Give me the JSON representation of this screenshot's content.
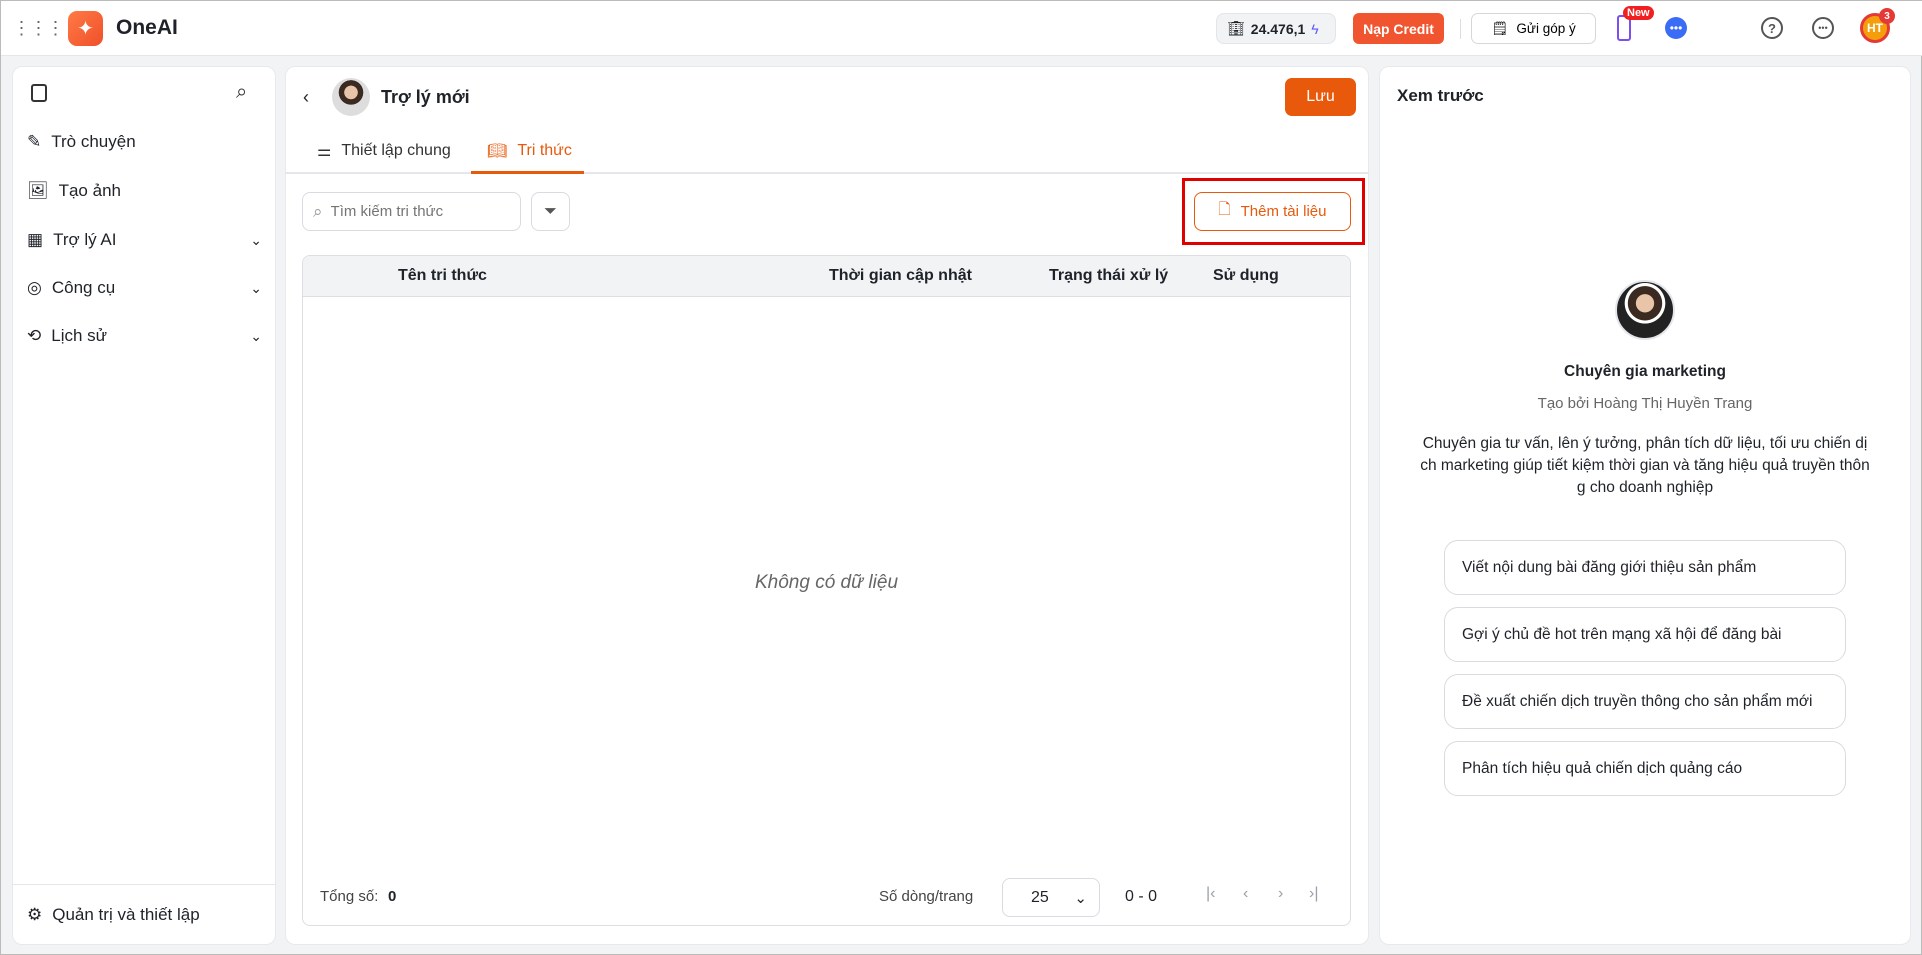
{
  "header": {
    "app_name": "OneAI",
    "credit": "24.476,1",
    "topup_label": "Nạp Credit",
    "feedback_label": "Gửi góp ý",
    "new_badge": "New",
    "avatar_initials": "HT",
    "notif_count": "3"
  },
  "sidebar": {
    "items": [
      {
        "label": "Trò chuyện"
      },
      {
        "label": "Tạo ảnh"
      },
      {
        "label": "Trợ lý AI"
      },
      {
        "label": "Công cụ"
      },
      {
        "label": "Lịch sử"
      }
    ],
    "admin_label": "Quản trị và thiết lập"
  },
  "main": {
    "title": "Trợ lý mới",
    "save_label": "Lưu",
    "tabs": [
      {
        "label": "Thiết lập chung"
      },
      {
        "label": "Tri thức"
      }
    ],
    "search_placeholder": "Tìm kiếm tri thức",
    "add_doc_label": "Thêm tài liệu",
    "table": {
      "columns": [
        "Tên tri thức",
        "Thời gian cập nhật",
        "Trạng thái xử lý",
        "Sử dụng"
      ],
      "empty": "Không có dữ liệu"
    },
    "footer": {
      "total_label": "Tổng số:",
      "total": "0",
      "rows_label": "Số dòng/trang",
      "page_size": "25",
      "range": "0 - 0"
    }
  },
  "preview": {
    "title": "Xem trước",
    "name": "Chuyên gia marketing",
    "author": "Tạo bởi Hoàng Thị Huyền Trang",
    "description": "Chuyên gia tư vấn, lên ý tưởng, phân tích dữ liệu, tối ưu chiến dịch marketing giúp tiết kiệm thời gian và tăng hiệu quả truyền thông cho doanh nghiệp",
    "suggestions": [
      "Viết nội dung bài đăng giới thiệu sản phẩm",
      "Gợi ý chủ đề hot trên mạng xã hội để đăng bài",
      "Đề xuất chiến dịch truyền thông cho sản phẩm mới",
      "Phân tích hiệu quả chiến dịch quảng cáo"
    ]
  },
  "colors": {
    "accent": "#e8590c",
    "highlight": "#e00000"
  }
}
